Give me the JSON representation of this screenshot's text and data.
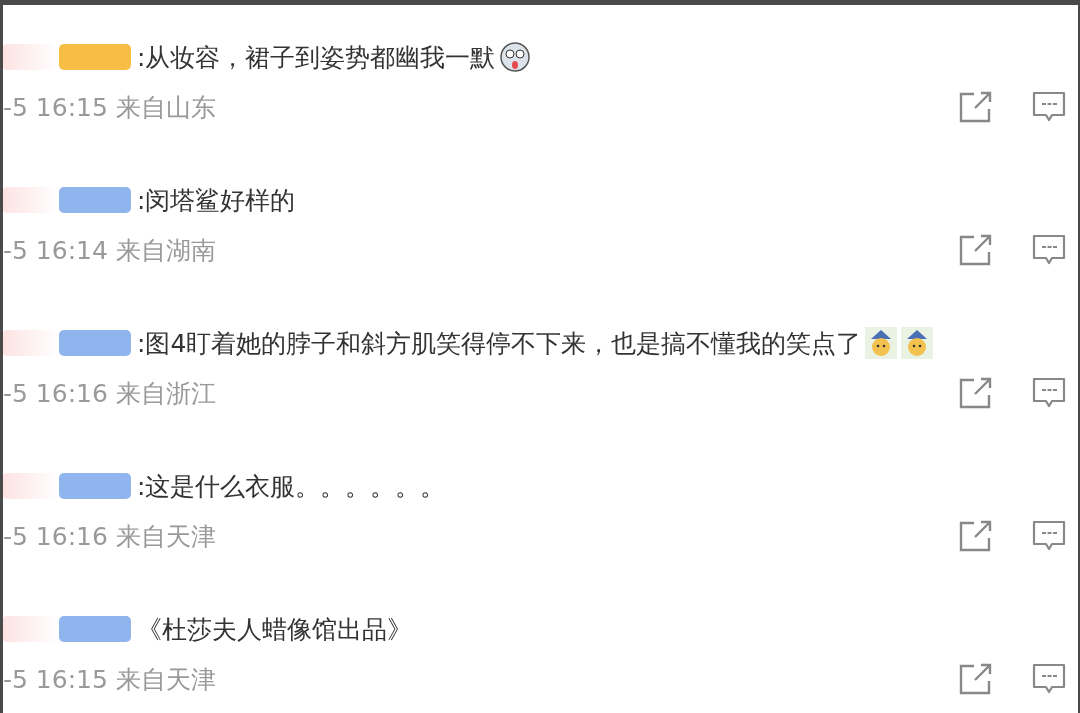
{
  "comments": [
    {
      "name_blur": {
        "color": "#f7bd45"
      },
      "text": ":从妆容，裙子到姿势都幽我一默",
      "emojis": [
        {
          "kind": "ghost"
        }
      ],
      "meta": "-5 16:15 来自山东"
    },
    {
      "name_blur": {
        "color": "#8fb4ee"
      },
      "text": ":闵塔鲨好样的",
      "meta": "-5 16:14 来自湖南"
    },
    {
      "name_blur": {
        "color": "#8fb4ee"
      },
      "text": ":图4盯着她的脖子和斜方肌笑得停不下来，也是搞不懂我的笑点了",
      "emojis": [
        {
          "kind": "doge"
        },
        {
          "kind": "doge"
        }
      ],
      "meta": "-5 16:16 来自浙江"
    },
    {
      "name_blur": {
        "color": "#8fb4ee"
      },
      "text": ":这是什么衣服。。。。。。",
      "meta": "-5 16:16 来自天津"
    },
    {
      "name_blur": {
        "color": "#8fb4ee"
      },
      "text": "《杜莎夫人蜡像馆出品》",
      "meta": "-5 16:15 来自天津"
    }
  ]
}
